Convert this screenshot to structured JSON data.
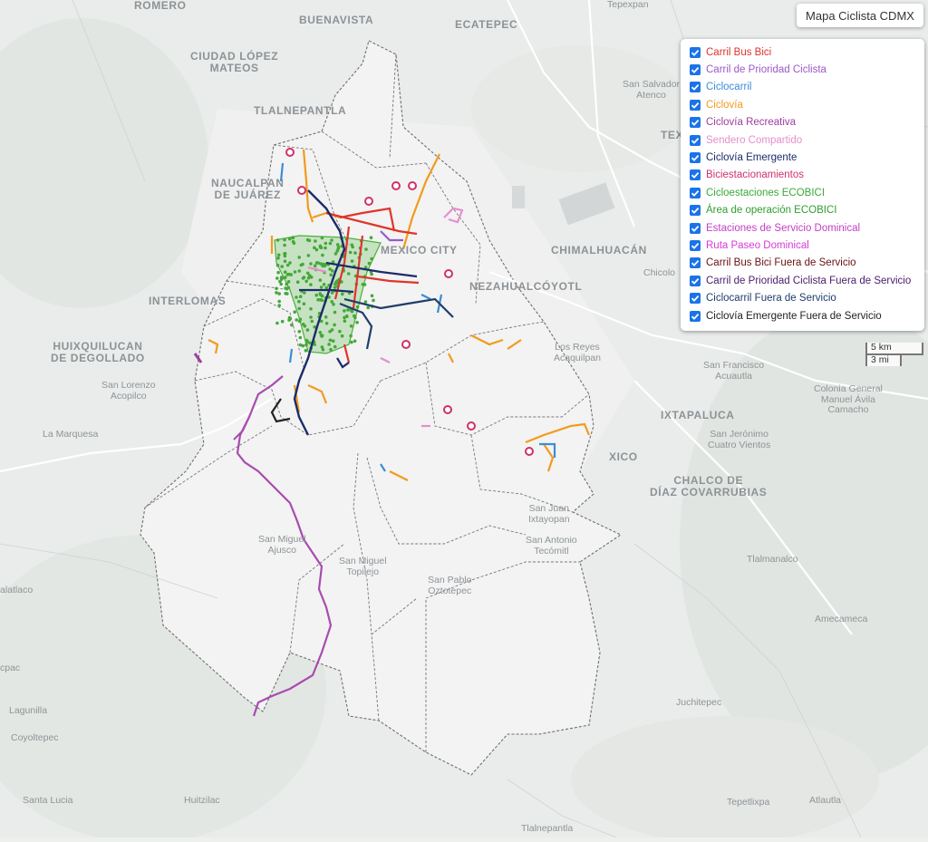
{
  "map_title": "Mapa Ciclista CDMX",
  "layers": [
    {
      "label": "Carril Bus Bici",
      "color": "#e0342b",
      "checked": true
    },
    {
      "label": "Carril de Prioridad Ciclista",
      "color": "#9b59c9",
      "checked": true
    },
    {
      "label": "Ciclocarril",
      "color": "#3c8dd6",
      "checked": true
    },
    {
      "label": "Ciclovía",
      "color": "#f39a1e",
      "checked": true
    },
    {
      "label": "Ciclovía Recreativa",
      "color": "#9e3d9c",
      "checked": true
    },
    {
      "label": "Sendero Compartido",
      "color": "#e58fce",
      "checked": true
    },
    {
      "label": "Ciclovía Emergente",
      "color": "#1c2b6b",
      "checked": true
    },
    {
      "label": "Biciestacionamientos",
      "color": "#d0306a",
      "checked": true
    },
    {
      "label": "Cicloestaciones ECOBICI",
      "color": "#3aa83a",
      "checked": true
    },
    {
      "label": "Área de operación ECOBICI",
      "color": "#2f9e2f",
      "checked": true
    },
    {
      "label": "Estaciones de Servicio Dominical",
      "color": "#c53cc8",
      "checked": true
    },
    {
      "label": "Ruta Paseo Dominical",
      "color": "#d63ad8",
      "checked": true
    },
    {
      "label": "Carril Bus Bici Fuera de Servicio",
      "color": "#6b1111",
      "checked": true
    },
    {
      "label": "Carril de Prioridad Ciclista Fuera de Servicio",
      "color": "#4a1c6b",
      "checked": true
    },
    {
      "label": "Ciclocarril Fuera de Servicio",
      "color": "#1f3d6b",
      "checked": true
    },
    {
      "label": "Ciclovía Emergente Fuera de Servicio",
      "color": "#222222",
      "checked": true
    }
  ],
  "scale": {
    "km": "5 km",
    "mi": "3 mi"
  },
  "places": [
    {
      "name": "ROMERO",
      "size": "big"
    },
    {
      "name": "Tepexpan",
      "size": "small"
    },
    {
      "name": "BUENAVISTA",
      "size": "big"
    },
    {
      "name": "ECATEPEC",
      "size": "big"
    },
    {
      "name": "CIUDAD LÓPEZ\nMATEOS",
      "size": "big"
    },
    {
      "name": "San Salvador\nAtenco",
      "size": "small"
    },
    {
      "name": "TLALNEPANTLA",
      "size": "big"
    },
    {
      "name": "TEX",
      "size": "big"
    },
    {
      "name": "NAUCALPAN\nDE JUÁREZ",
      "size": "big"
    },
    {
      "name": "MEXICO CITY",
      "size": "big"
    },
    {
      "name": "CHIMALHUACÁN",
      "size": "big"
    },
    {
      "name": "Chicolo",
      "size": "small"
    },
    {
      "name": "INTERLOMAS",
      "size": "big"
    },
    {
      "name": "NEZAHUALCÓYOTL",
      "size": "big"
    },
    {
      "name": "HUIXQUILUCAN\nDE DEGOLLADO",
      "size": "big"
    },
    {
      "name": "Los Reyes\nAcaquilpan",
      "size": "small"
    },
    {
      "name": "San Francisco\nAcuautla",
      "size": "small"
    },
    {
      "name": "San Lorenzo\nAcopilco",
      "size": "small"
    },
    {
      "name": "Colonia General\nManuel Ávila\nCamacho",
      "size": "small"
    },
    {
      "name": "IXTAPALUCA",
      "size": "big"
    },
    {
      "name": "La Marquesa",
      "size": "small"
    },
    {
      "name": "San Jerónimo\nCuatro Vientos",
      "size": "small"
    },
    {
      "name": "XICO",
      "size": "big"
    },
    {
      "name": "CHALCO DE\nDÍAZ COVARRUBIAS",
      "size": "big"
    },
    {
      "name": "San Juan\nIxtayopan",
      "size": "small"
    },
    {
      "name": "San Miguel\nAjusco",
      "size": "small"
    },
    {
      "name": "San Antonio\nTecómitl",
      "size": "small"
    },
    {
      "name": "San Miguel\nTopilejo",
      "size": "small"
    },
    {
      "name": "Tlalmanalco",
      "size": "small"
    },
    {
      "name": "San Pablo\nOztotepec",
      "size": "small"
    },
    {
      "name": "alatlaco",
      "size": "small"
    },
    {
      "name": "Amecameca",
      "size": "small"
    },
    {
      "name": "cpac",
      "size": "small"
    },
    {
      "name": "Juchitepec",
      "size": "small"
    },
    {
      "name": "Lagunilla",
      "size": "small"
    },
    {
      "name": "Coyoltepec",
      "size": "small"
    },
    {
      "name": "Santa Lucia",
      "size": "small"
    },
    {
      "name": "Huitzilac",
      "size": "small"
    },
    {
      "name": "Tepetlixpa",
      "size": "small"
    },
    {
      "name": "Atlautla",
      "size": "small"
    },
    {
      "name": "Tlalnepantla",
      "size": "small"
    }
  ]
}
